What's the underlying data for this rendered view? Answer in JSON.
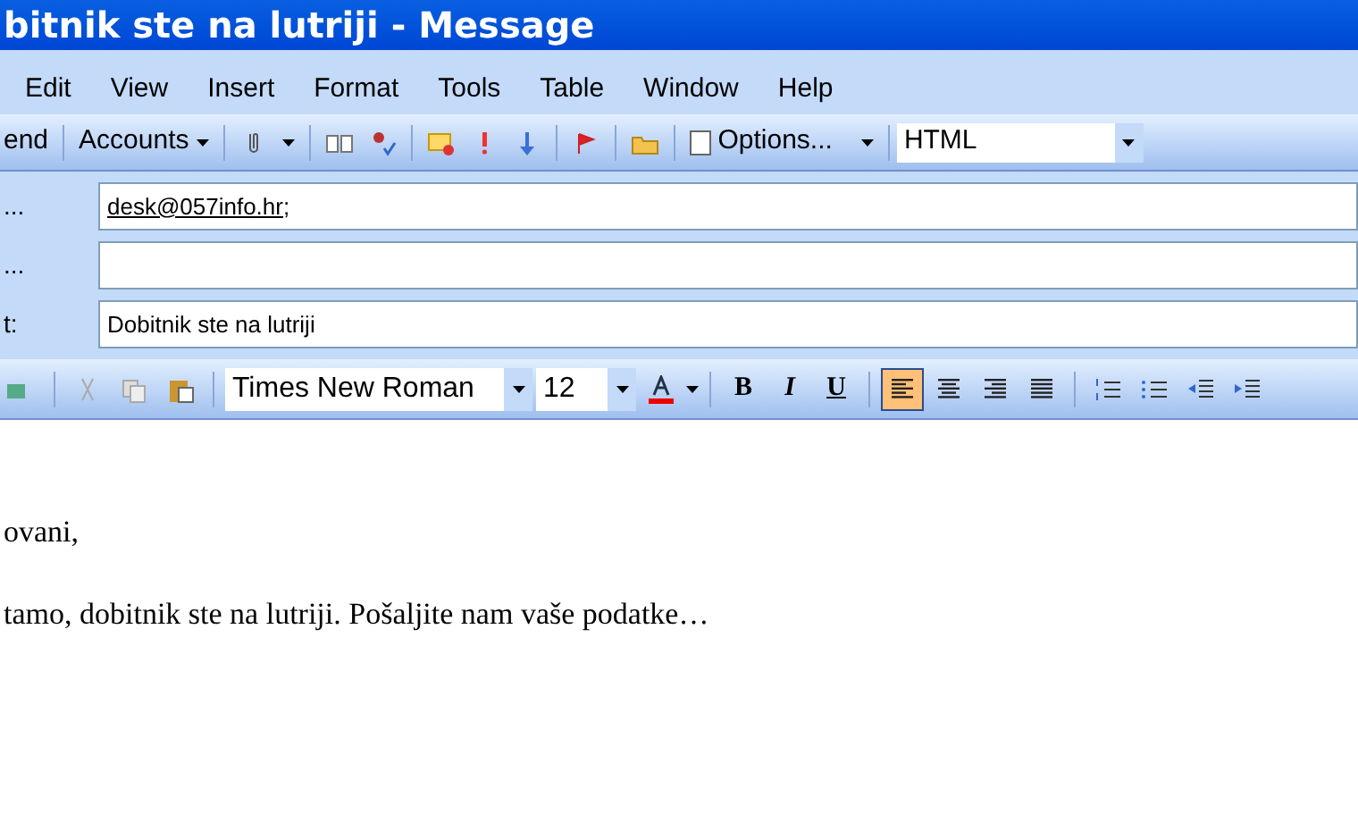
{
  "window": {
    "title": "bitnik ste na lutriji - Message"
  },
  "menu": [
    "Edit",
    "View",
    "Insert",
    "Format",
    "Tools",
    "Table",
    "Window",
    "Help"
  ],
  "toolbar": {
    "send": "end",
    "accounts": "Accounts",
    "options": "Options...",
    "format": "HTML"
  },
  "address_rows": [
    {
      "label": "...",
      "kind": "recipient",
      "value": "desk@057info.hr",
      "suffix": ";"
    },
    {
      "label": "...",
      "kind": "recipient"
    },
    {
      "label": "t:",
      "kind": "text",
      "value": "Dobitnik ste na lutriji"
    }
  ],
  "format_bar": {
    "font": "Times New Roman",
    "size": "12",
    "bold": "B",
    "italic": "I",
    "underline": "U",
    "alignments": [
      {
        "kind": "left",
        "selected": true
      },
      {
        "kind": "center",
        "selected": false
      },
      {
        "kind": "right",
        "selected": false
      },
      {
        "kind": "justify",
        "selected": false
      }
    ]
  },
  "body": [
    "ovani,",
    "tamo, dobitnik ste na lutriji. Pošaljite nam vaše podatke…"
  ]
}
